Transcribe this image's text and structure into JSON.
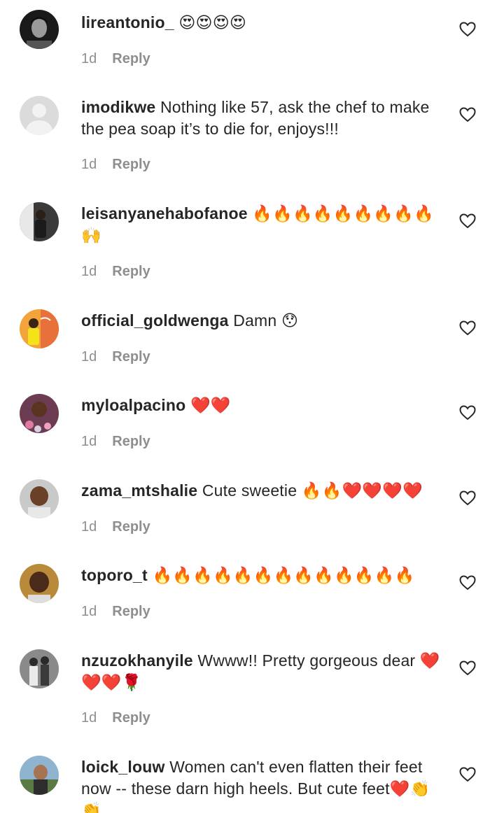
{
  "comments": [
    {
      "username": "lireantonio_",
      "text": "😍😍😍😍",
      "time": "1d",
      "reply": "Reply",
      "avatar": "avatar-bw-portrait-icon"
    },
    {
      "username": "imodikwe",
      "text": "Nothing like 57, ask the chef to make the pea soap it’s to die for, enjoys!!!",
      "time": "1d",
      "reply": "Reply",
      "avatar": "default-avatar-icon"
    },
    {
      "username": "leisanyanehabofanoe",
      "text": "🔥🔥🔥🔥🔥🔥🔥🔥🔥🙌",
      "time": "1d",
      "reply": "Reply",
      "avatar": "avatar-person-icon"
    },
    {
      "username": "official_goldwenga",
      "text": "Damn 😯",
      "time": "1d",
      "reply": "Reply",
      "avatar": "avatar-orange-icon"
    },
    {
      "username": "myloalpacino",
      "text": "❤️❤️",
      "time": "1d",
      "reply": "Reply",
      "avatar": "avatar-child-icon"
    },
    {
      "username": "zama_mtshalie",
      "text": "Cute sweetie 🔥🔥❤️❤️❤️❤️",
      "time": "1d",
      "reply": "Reply",
      "avatar": "avatar-face-icon"
    },
    {
      "username": "toporo_t",
      "text": "🔥🔥🔥🔥🔥🔥🔥🔥🔥🔥🔥🔥🔥",
      "time": "1d",
      "reply": "Reply",
      "avatar": "avatar-face-icon"
    },
    {
      "username": "nzuzokhanyile",
      "text": "Wwww!! Pretty gorgeous dear ❤️❤️❤️🌹",
      "time": "1d",
      "reply": "Reply",
      "avatar": "avatar-couple-icon"
    },
    {
      "username": "loick_louw",
      "text": "Women can't even flatten their feet now -- these darn high heels. But cute feet❤️👏👏",
      "time": "",
      "reply": "",
      "avatar": "avatar-outdoor-icon"
    }
  ],
  "colors": {
    "text": "#262626",
    "secondary": "#8e8e8e",
    "background": "#ffffff"
  }
}
